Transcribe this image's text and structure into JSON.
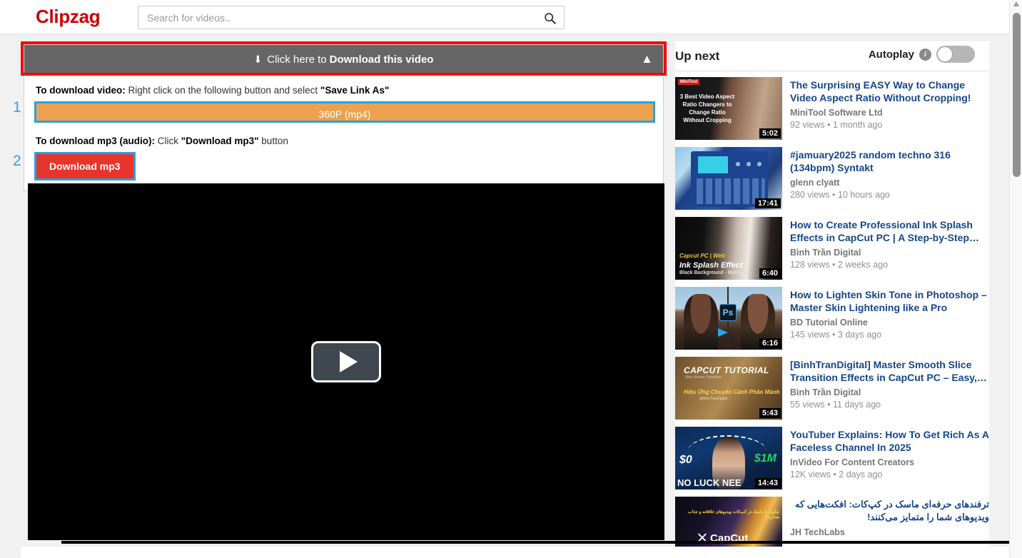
{
  "header": {
    "brand": "Clipzag",
    "search_placeholder": "Search for videos..",
    "search_value": "",
    "search_icon": "search-icon"
  },
  "download_panel": {
    "header_prefix": "Click here to",
    "header_strong": "Download this video",
    "download_icon": "download-icon",
    "collapse_icon": "chevron-up-icon",
    "instruction_video_label": "To download video:",
    "instruction_video_text": " Right click on the following button and select ",
    "instruction_video_quoted": "\"Save Link As\"",
    "video_button_label": "360P (mp4)",
    "instruction_mp3_label": "To download mp3 (audio):",
    "instruction_mp3_text": " Click ",
    "instruction_mp3_quoted": "\"Download mp3\"",
    "instruction_mp3_suffix": " button",
    "mp3_button_label": "Download mp3",
    "annotation_1": "1",
    "annotation_2": "2",
    "annotation_box_color": "#ff0000",
    "annotation_highlight_color": "#29a0e0",
    "header_bg": "#666666",
    "video_button_bg": "#eca24e",
    "mp3_button_bg": "#e8342b"
  },
  "player": {
    "play_icon": "play-icon",
    "background": "#000000"
  },
  "sidebar": {
    "title": "Up next",
    "autoplay_label": "Autoplay",
    "autoplay_info_icon": "info-icon",
    "autoplay_on": false,
    "videos": [
      {
        "title": "The Surprising EASY Way to Change Video Aspect Ratio Without Cropping!",
        "channel": "MiniTool Software Ltd",
        "stats": "92 views • 1 month ago",
        "duration": "5:02",
        "thumb_class": "t1",
        "thumb_overlay_logo": "MiniTool",
        "thumb_overlay_text": "3 Best Video Aspect Ratio Changers to Change Ratio Without Cropping",
        "rtl": false
      },
      {
        "title": "#jamuary2025 random techno 316 (134bpm) Syntakt",
        "channel": "glenn clyatt",
        "stats": "280 views • 10 hours ago",
        "duration": "17:41",
        "thumb_class": "t2",
        "rtl": false
      },
      {
        "title": "How to Create Professional Ink Splash Effects in CapCut PC | A Step-by-Step…",
        "channel": "Bình Trần Digital",
        "stats": "128 views • 2 weeks ago",
        "duration": "6:40",
        "thumb_class": "t3",
        "thumb_overlay_yellow": "Capcut PC | Web",
        "thumb_overlay_white": "Ink Splash Effect",
        "thumb_overlay_small": "Black Background - Multiply",
        "rtl": false
      },
      {
        "title": "How to Lighten Skin Tone in Photoshop – Master Skin Lightening like a Pro",
        "channel": "BD Tutorial Online",
        "stats": "145 views • 3 days ago",
        "duration": "6:16",
        "thumb_class": "t4",
        "thumb_badge": "Ps",
        "rtl": false
      },
      {
        "title": "[BinhTranDigital] Master Smooth Slice Transition Effects in CapCut PC – Easy,…",
        "channel": "Bình Trần Digital",
        "stats": "55 views • 11 days ago",
        "duration": "5:43",
        "thumb_class": "t5",
        "thumb_overlay_title": "CAPCUT TUTORIAL",
        "thumb_overlay_sub": "Slice Screen Transition",
        "thumb_overlay_vn": "Hiệu Ứng Chuyển Cảnh Phân Mảnh",
        "thumb_overlay_handle": "@BinhTranDigital",
        "rtl": false
      },
      {
        "title": "YouTuber Explains: How To Get Rich As A Faceless Channel In 2025",
        "channel": "InVideo For Content Creators",
        "stats": "12K views • 2 days ago",
        "duration": "14:43",
        "thumb_class": "t6",
        "thumb_money_left": "$0",
        "thumb_money_right": "$1M",
        "thumb_bottom_text": "NO LUCK NEE",
        "rtl": false
      },
      {
        "title": "ترفندهای حرفه‌ای ماسک در کپ‌کات: افکت‌هایی که ویدیوهای شما را متمایز می‌کنند!",
        "channel": "JH TechLabs",
        "stats": "",
        "duration": "",
        "thumb_class": "t7",
        "thumb_brand": "CapCut",
        "thumb_fa_text": "چگونه با ماسک در کپ‌کات ویدیوهای خلاقانه و جذاب بسازیم؟",
        "rtl": true
      }
    ]
  },
  "scrollbar": {
    "vertical_visible": true,
    "vertical_thumb_position": "near-top"
  }
}
